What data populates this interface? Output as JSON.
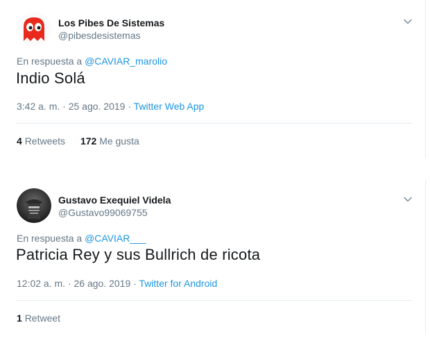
{
  "tweets": [
    {
      "author_name": "Los Pibes De Sistemas",
      "author_handle": "@pibesdesistemas",
      "reply_prefix": "En respuesta a",
      "reply_to": "@CAVIAR_marolio",
      "text": "Indio Solá",
      "time": "3:42 a. m. · 25 ago. 2019 ·",
      "source": "Twitter Web App",
      "retweets_count": "4",
      "retweets_label": "Retweets",
      "likes_count": "172",
      "likes_label": "Me gusta",
      "avatar_icon": "red-ghost-icon"
    },
    {
      "author_name": "Gustavo Exequiel Videla",
      "author_handle": "@Gustavo99069755",
      "reply_prefix": "En respuesta a",
      "reply_to": "@CAVIAR___",
      "text": "Patricia Rey y sus Bullrich de ricota",
      "time": "12:02 a. m. · 26 ago. 2019 ·",
      "source": "Twitter for Android",
      "retweets_count": "1",
      "retweets_label": "Retweet",
      "avatar_icon": "profile-photo"
    }
  ],
  "colors": {
    "link": "#1b95e0",
    "secondary_text": "#657786",
    "primary_text": "#14171a",
    "divider": "#e6ecf0"
  }
}
